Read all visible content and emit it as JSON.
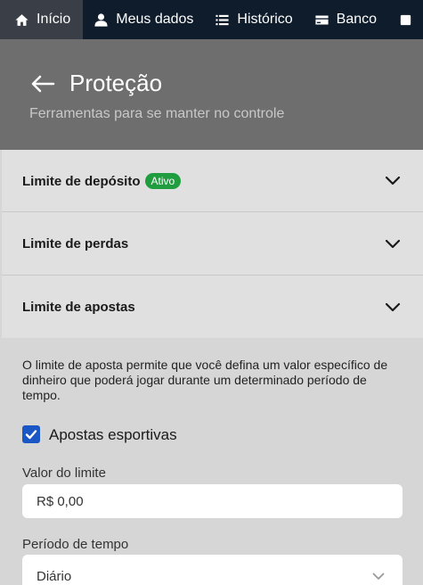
{
  "nav": {
    "tabs": [
      {
        "label": "Início",
        "icon": "home-icon",
        "active": true
      },
      {
        "label": "Meus dados",
        "icon": "user-icon"
      },
      {
        "label": "Histórico",
        "icon": "list-icon"
      },
      {
        "label": "Banco",
        "icon": "card-icon"
      },
      {
        "label": "",
        "icon": "more-icon"
      }
    ]
  },
  "header": {
    "title": "Proteção",
    "subtitle": "Ferramentas para se manter no controle"
  },
  "sections": [
    {
      "label": "Limite de depósito",
      "badge": "Ativo"
    },
    {
      "label": "Limite de perdas"
    },
    {
      "label": "Limite de apostas",
      "expanded": true
    }
  ],
  "bets_panel": {
    "description": "O limite de aposta permite que você defina um valor específico de dinheiro que poderá jogar durante um determinado período de tempo.",
    "checkbox_label": "Apostas esportivas",
    "checkbox_checked": true,
    "limit_label": "Valor do limite",
    "limit_value": "R$ 0,00",
    "period_label": "Período de tempo",
    "period_value": "Diário"
  },
  "colors": {
    "nav_bg": "#0f1c2c",
    "header_bg": "#6e6e6e",
    "badge_green": "#1f9d3f",
    "checkbox_blue": "#1a56c4"
  }
}
